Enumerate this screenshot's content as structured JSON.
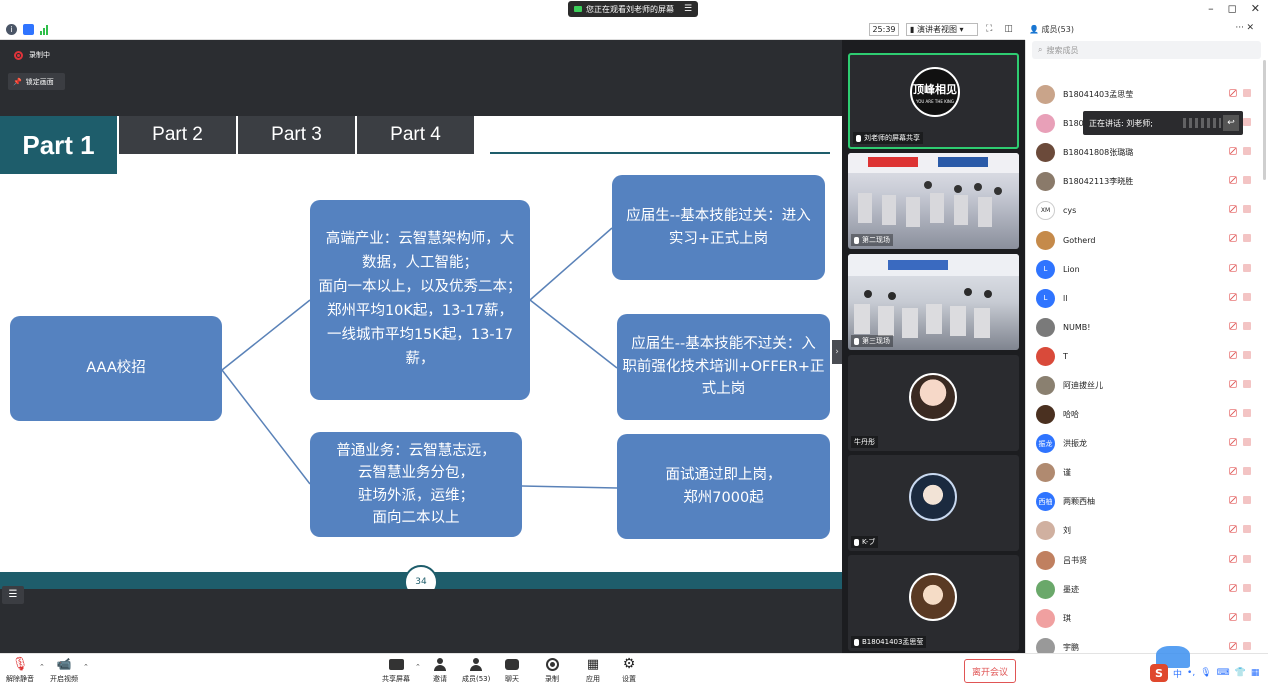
{
  "titlebar": {
    "viewing_notice": "您正在观看刘老师的屏幕",
    "menu_icon": "menu-icon",
    "minimize": "–",
    "restore": "◻",
    "close": "✕"
  },
  "toolbar": {
    "timer": "25:39",
    "view_mode": "演讲者视图",
    "members_title": "成员(53)",
    "more": "···",
    "close": "✕"
  },
  "stage": {
    "recording": "录制中",
    "lock_screen": "锁定画面"
  },
  "slide": {
    "tabs": [
      "Part 1",
      "Part 2",
      "Part 3",
      "Part 4"
    ],
    "root": "AAA校招",
    "mid_top": "高端产业：云智慧架构师，大数据，人工智能；\n面向一本以上，以及优秀二本；\n郑州平均10K起，13-17薪，\n一线城市平均15K起，13-17薪，",
    "mid_top_lines": [
      "高端产业：云智慧架构师，大",
      "数据，人工智能；",
      "面向一本以上，以及优秀二本；",
      "郑州平均10K起，13-17薪，",
      "一线城市平均15K起，13-17薪，"
    ],
    "mid_bottom_lines": [
      "普通业务：云智慧志远，",
      "云智慧业务分包，",
      "驻场外派，运维；",
      "面向二本以上"
    ],
    "right_1_lines": [
      "应届生--基本技能过关：进入",
      "实习+正式上岗"
    ],
    "right_2_lines": [
      "应届生--基本技能不过关：入",
      "职前强化技术培训+OFFER+正",
      "式上岗"
    ],
    "right_3_lines": [
      "面试通过即上岗，",
      "郑州7000起"
    ],
    "page_number": "34"
  },
  "videos": [
    {
      "label": "刘老师的屏幕共享",
      "logo_text": "顶峰相见",
      "logo_sub": "YOU ARE THE KING"
    },
    {
      "label": "第二现场"
    },
    {
      "label": "第三现场"
    },
    {
      "label": "牛丹彤"
    },
    {
      "label": "K-ブ"
    },
    {
      "label": "B18041403孟思莹"
    }
  ],
  "members": {
    "search_placeholder": "搜索成员",
    "speaking_label": "正在讲话: 刘老师;",
    "list": [
      {
        "name": "B18041403孟思莹",
        "color": "#c9a48a",
        "initial": ""
      },
      {
        "name": "B1804",
        "color": "#e8a0b8",
        "initial": ""
      },
      {
        "name": "B18041808张璐璐",
        "color": "#6b4a3a",
        "initial": ""
      },
      {
        "name": "B18042113李晓胜",
        "color": "#8a7a6a",
        "initial": ""
      },
      {
        "name": "cys",
        "color": "#ffffff",
        "initial": "XM"
      },
      {
        "name": "Gotherd",
        "color": "#c58a4a",
        "initial": ""
      },
      {
        "name": "Lion",
        "color": "#2f74ff",
        "initial": "L"
      },
      {
        "name": "ll",
        "color": "#2f74ff",
        "initial": "L"
      },
      {
        "name": "NUMB!",
        "color": "#7a7a7a",
        "initial": ""
      },
      {
        "name": "T",
        "color": "#d94a3a",
        "initial": ""
      },
      {
        "name": "阿迪拔丝儿",
        "color": "#8a8070",
        "initial": ""
      },
      {
        "name": "哈哈",
        "color": "#4a3020",
        "initial": ""
      },
      {
        "name": "洪振龙",
        "color": "#2f74ff",
        "initial": "振龙"
      },
      {
        "name": "谨",
        "color": "#b08a70",
        "initial": ""
      },
      {
        "name": "两颗西柚",
        "color": "#2f74ff",
        "initial": "西柚"
      },
      {
        "name": "刘",
        "color": "#d0b0a0",
        "initial": ""
      },
      {
        "name": "吕书贤",
        "color": "#c08060",
        "initial": ""
      },
      {
        "name": "墨迹",
        "color": "#6aa86a",
        "initial": ""
      },
      {
        "name": "琪",
        "color": "#f0a0a0",
        "initial": ""
      },
      {
        "name": "宇鹏",
        "color": "#999999",
        "initial": ""
      }
    ]
  },
  "bottombar": {
    "mute": "解除静音",
    "video": "开启视频",
    "share": "共享屏幕",
    "invite": "邀请",
    "members": "成员(53)",
    "chat": "聊天",
    "record": "录制",
    "apps": "应用",
    "settings": "设置",
    "leave": "离开会议",
    "ime_lang": "中"
  },
  "colors": {
    "slide_teal": "#1e5d6b",
    "box_blue": "#5582c0",
    "tab_dark": "#3b3e43",
    "leave_red": "#e05555",
    "active_green": "#2ecc71"
  }
}
